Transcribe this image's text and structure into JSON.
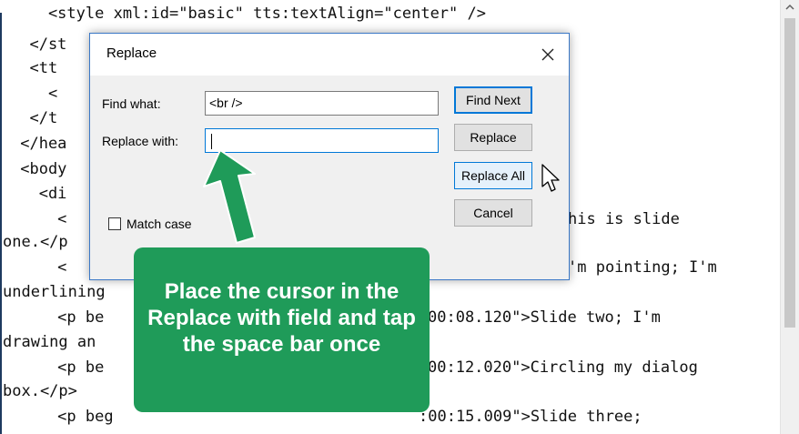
{
  "editor": {
    "lines": [
      "    <style xml:id=\"basic\" tts:textAlign=\"center\" />",
      "  </st",
      "  <tt",
      "    <",
      "  </t",
      " </hea",
      " <body",
      "   <di",
      "     <",
      "one.</p",
      "     <",
      "underlining",
      "     <p be",
      "drawing an",
      "     <p be",
      "box.</p>",
      "     <p beg"
    ],
    "right_fragments": [
      "his is slide",
      "'m pointing; I'm",
      "00:08.120\">Slide two; I'm",
      "00:12.020\">Circling my dialog",
      ":00:15.009\">Slide three;"
    ]
  },
  "dialog": {
    "title": "Replace",
    "find_label": "Find what:",
    "find_value": "<br />",
    "replace_label": "Replace with:",
    "replace_value": "",
    "match_case_label": "Match case",
    "buttons": {
      "find_next": "Find Next",
      "replace": "Replace",
      "replace_all": "Replace All",
      "cancel": "Cancel"
    }
  },
  "callout": {
    "text": "Place the cursor in the Replace with field and tap the space bar once"
  },
  "colors": {
    "callout_green": "#1f9b59",
    "dialog_accent": "#0078d7"
  },
  "icons": [
    "close-icon",
    "checkbox-icon",
    "arrow-icon",
    "mouse-pointer-icon",
    "scroll-up-icon"
  ]
}
